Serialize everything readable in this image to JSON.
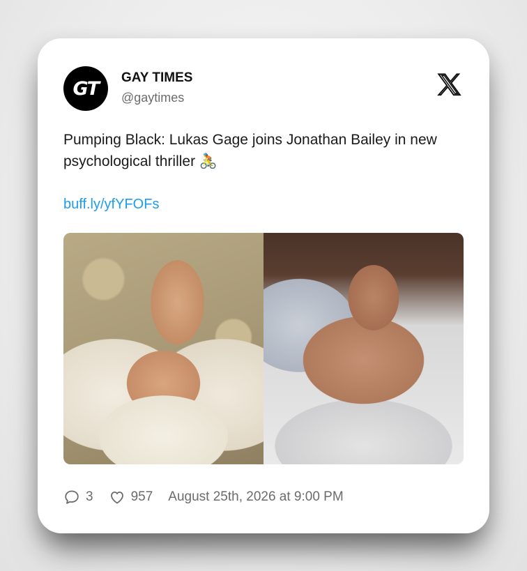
{
  "account": {
    "avatar_text": "GT",
    "name": "GAY TIMES",
    "handle": "@gaytimes"
  },
  "platform_icon": "x-logo-icon",
  "tweet": {
    "text": "Pumping Black: Lukas Gage joins Jonathan Bailey in new psychological thriller 🚴",
    "link": "buff.ly/yfYFOFs"
  },
  "media": [
    {
      "icon": "photo",
      "description_hidden": true
    },
    {
      "icon": "photo",
      "description_hidden": true
    }
  ],
  "stats": {
    "replies": "3",
    "likes": "957",
    "timestamp": "August 25th, 2026 at 9:00 PM"
  },
  "colors": {
    "link": "#1d9bf0",
    "muted": "#6b6b6b",
    "text": "#1a1a1a"
  }
}
